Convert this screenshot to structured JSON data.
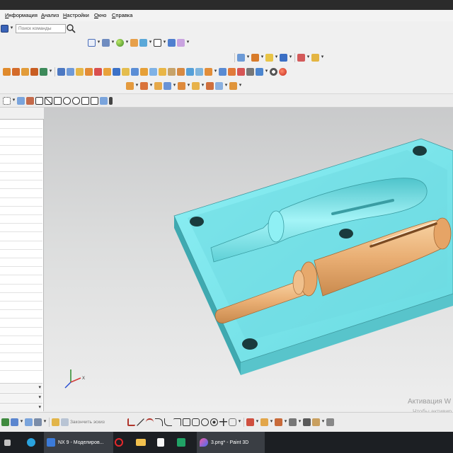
{
  "menu": {
    "items": [
      {
        "label": "Информация",
        "underline": "И"
      },
      {
        "label": "Анализ",
        "underline": "А"
      },
      {
        "label": "Настройки",
        "underline": "Н"
      },
      {
        "label": "Окно",
        "underline": "О"
      },
      {
        "label": "Справка",
        "underline": "С"
      }
    ]
  },
  "command_finder": {
    "placeholder": "Поиск команды"
  },
  "sketch_toolbar": {
    "finish_sketch_label": "Закончить эскиз"
  },
  "watermark": {
    "line1": "Активация W",
    "line2": "Чтобы активир"
  },
  "taskbar": {
    "nx_label": "NX 9 - Моделиров...",
    "paint_label": "3.png* - Paint 3D"
  },
  "icons": {
    "search": "search-icon",
    "telegram": "telegram-icon",
    "opera": "opera-icon",
    "folder": "folder-icon",
    "excel": "excel-icon",
    "paint3d": "paint3d-icon"
  },
  "colors": {
    "mold_plate": "#7fe6ec",
    "mold_plate_side": "#4fbcc3",
    "part": "#e9b27c",
    "viewport_top": "#c9cacb",
    "viewport_bottom": "#eeeeee",
    "taskbar": "#1c1f23"
  }
}
